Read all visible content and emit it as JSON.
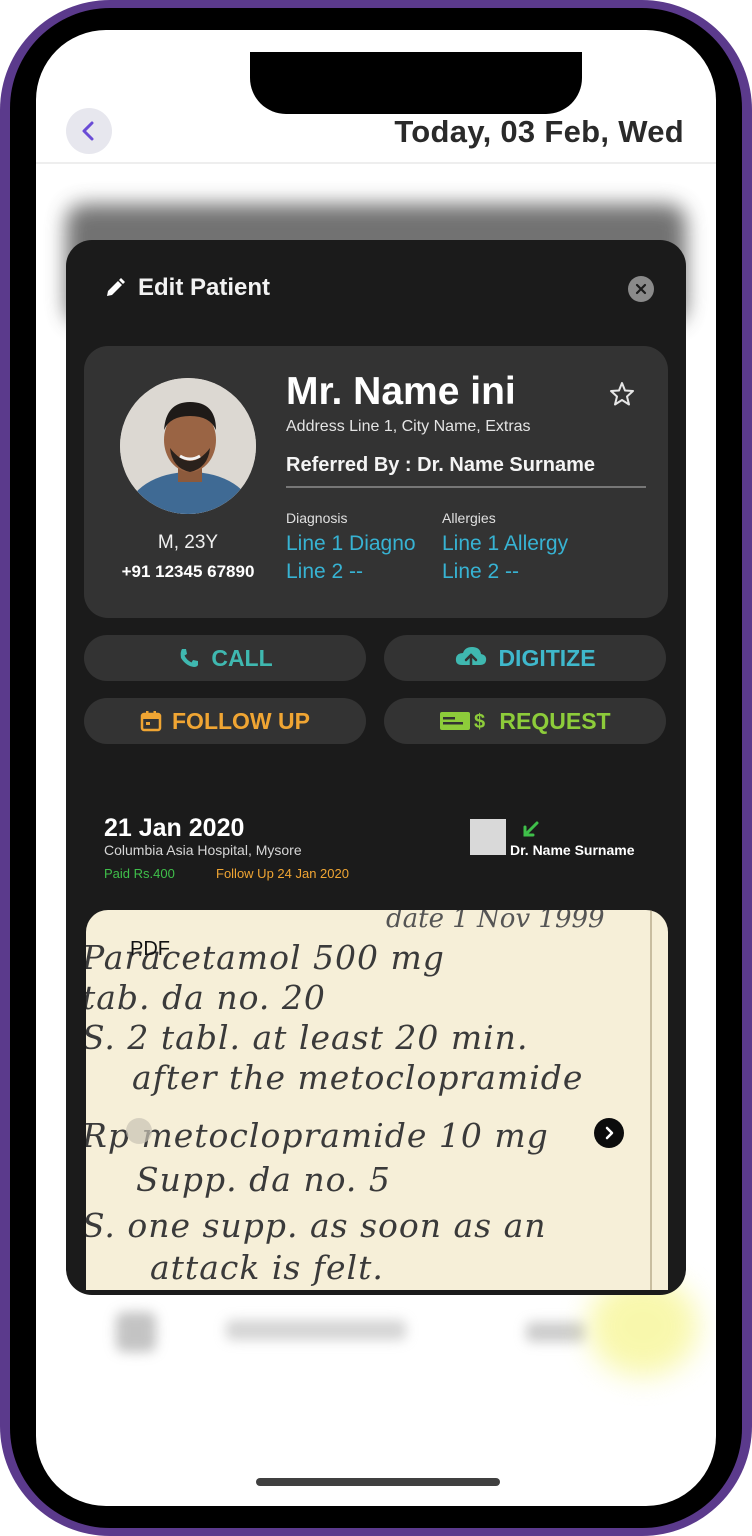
{
  "header": {
    "date_title": "Today, 03 Feb, Wed"
  },
  "modal": {
    "title": "Edit Patient",
    "patient": {
      "name": "Mr. Name ini",
      "address": "Address Line 1, City Name, Extras",
      "referred_by": "Referred By : Dr. Name Surname",
      "gender_age": "M, 23Y",
      "phone": "+91 12345 67890",
      "diagnosis": {
        "label": "Diagnosis",
        "line1": "Line 1 Diagno",
        "line2": "Line 2 --"
      },
      "allergies": {
        "label": "Allergies",
        "line1": "Line 1 Allergy",
        "line2": "Line 2 --"
      }
    },
    "actions": {
      "call": "CALL",
      "digitize": "DIGITIZE",
      "follow_up": "FOLLOW UP",
      "request": "REQUEST"
    },
    "visit": {
      "date": "21 Jan 2020",
      "place": "Columbia Asia Hospital, Mysore",
      "paid": "Paid Rs.400",
      "follow_up": "Follow Up 24 Jan 2020",
      "doctor": "Dr. Name Surname"
    },
    "document": {
      "type_label": "PDF",
      "lines": [
        "date  1 Nov 1999",
        "Paracetamol  500 mg",
        "tab. da  no. 20",
        "S. 2 tabl. at least 20 min.",
        "after the metoclopramide",
        "Rp  metoclopramide  10 mg",
        "Supp.  da  no. 5",
        "S.  one supp. as soon as an",
        "attack  is felt."
      ]
    }
  },
  "colors": {
    "accent_blue": "#37b3d3",
    "call": "#3fb8b0",
    "digitize": "#3fb8cc",
    "follow_up": "#f0a533",
    "request": "#8dcc3a",
    "paid": "#3fbf4a"
  }
}
